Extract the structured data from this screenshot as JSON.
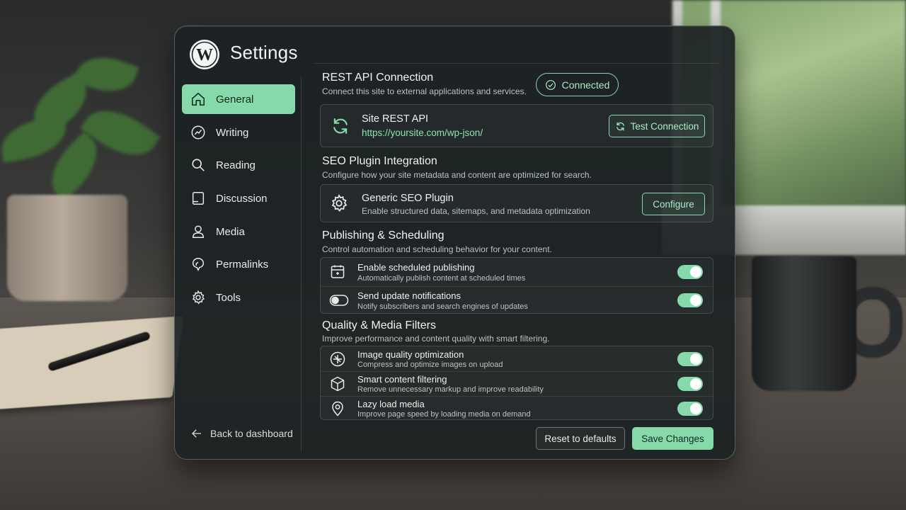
{
  "app": {
    "title": "Settings",
    "logo_icon": "wordpress-logo-icon"
  },
  "colors": {
    "accent": "#86d9ab",
    "panel": "#1c2224",
    "accent_text": "#a8ecc6"
  },
  "sidebar": {
    "items": [
      {
        "label": "General",
        "icon": "home-icon",
        "active": true
      },
      {
        "label": "Writing",
        "icon": "writing-icon",
        "active": false
      },
      {
        "label": "Reading",
        "icon": "search-icon",
        "active": false
      },
      {
        "label": "Discussion",
        "icon": "discussion-icon",
        "active": false
      },
      {
        "label": "Media",
        "icon": "user-icon",
        "active": false
      },
      {
        "label": "Permalinks",
        "icon": "permalink-icon",
        "active": false
      },
      {
        "label": "Tools",
        "icon": "gear-icon",
        "active": false
      }
    ],
    "back_label": "Back to dashboard"
  },
  "rest_api": {
    "title": "REST API Connection",
    "subtitle": "Connect this site to external applications and services.",
    "status": "Connected",
    "card_title": "Site REST API",
    "card_url": "https://yoursite.com/wp-json/",
    "test_button": "Test Connection"
  },
  "seo": {
    "title": "SEO Plugin Integration",
    "subtitle": "Configure how your site metadata and content are optimized for search.",
    "card_title": "Generic SEO Plugin",
    "card_subtitle": "Enable structured data, sitemaps, and metadata optimization",
    "configure_button": "Configure"
  },
  "publishing": {
    "title": "Publishing & Scheduling",
    "subtitle": "Control automation and scheduling behavior for your content.",
    "rows": [
      {
        "title": "Enable scheduled publishing",
        "subtitle": "Automatically publish content at scheduled times",
        "enabled": true
      },
      {
        "title": "Send update notifications",
        "subtitle": "Notify subscribers and search engines of updates",
        "enabled": true
      }
    ]
  },
  "quality": {
    "title": "Quality & Media Filters",
    "subtitle": "Improve performance and content quality with smart filtering.",
    "rows": [
      {
        "title": "Image quality optimization",
        "subtitle": "Compress and optimize images on upload",
        "enabled": true
      },
      {
        "title": "Smart content filtering",
        "subtitle": "Remove unnecessary markup and improve readability",
        "enabled": true
      },
      {
        "title": "Lazy load media",
        "subtitle": "Improve page speed by loading media on demand",
        "enabled": true
      }
    ]
  },
  "footer": {
    "reset_label": "Reset to defaults",
    "save_label": "Save Changes"
  }
}
